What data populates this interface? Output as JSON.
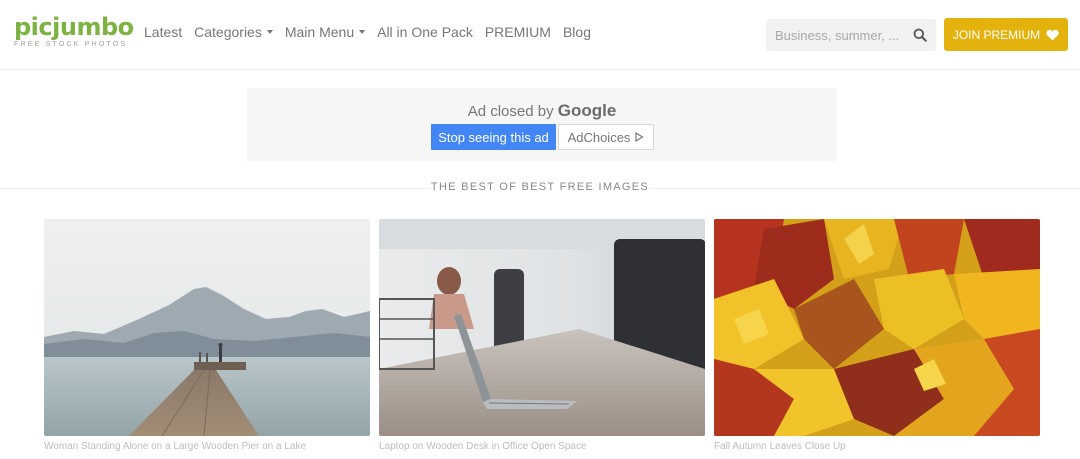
{
  "header": {
    "logo": {
      "name": "picjumbo",
      "tagline": "FREE STOCK PHOTOS"
    },
    "nav": [
      {
        "label": "Latest",
        "dropdown": false
      },
      {
        "label": "Categories",
        "dropdown": true
      },
      {
        "label": "Main Menu",
        "dropdown": true
      },
      {
        "label": "All in One Pack",
        "dropdown": false
      },
      {
        "label": "PREMIUM",
        "dropdown": false
      },
      {
        "label": "Blog",
        "dropdown": false
      }
    ],
    "search": {
      "placeholder": "Business, summer, ...",
      "icon": "search-icon"
    },
    "join_button": {
      "label": "JOIN PREMIUM",
      "icon": "heart-icon",
      "color": "#e3b20c"
    }
  },
  "ad": {
    "closed_text": "Ad closed by",
    "provider": "Google",
    "stop_button": "Stop seeing this ad",
    "adchoices_button": "AdChoices",
    "adchoices_icon": "play-triangle-icon"
  },
  "section": {
    "title": "THE BEST OF BEST FREE IMAGES"
  },
  "images": [
    {
      "caption": "Woman Standing Alone on a Large Wooden Pier on a Lake"
    },
    {
      "caption": "Laptop on Wooden Desk in Office Open Space"
    },
    {
      "caption": "Fall Autumn Leaves Close Up"
    }
  ],
  "colors": {
    "brand": "#7cb342",
    "accent": "#e3b20c",
    "ad_button": "#4285f4"
  }
}
